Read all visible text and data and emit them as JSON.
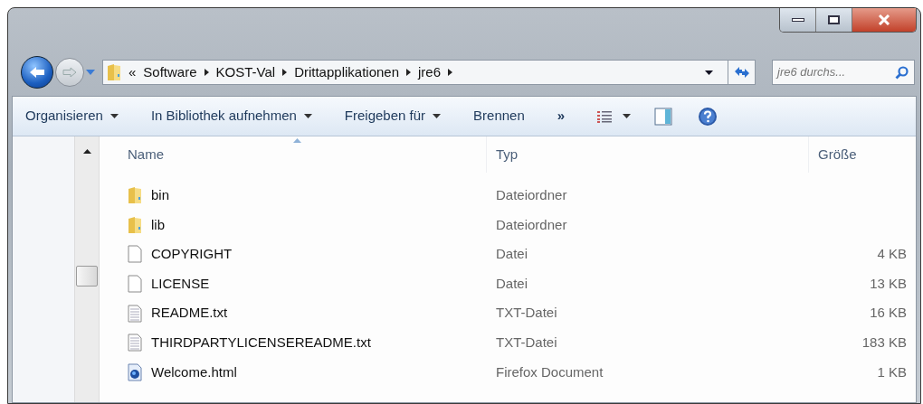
{
  "address_bar": {
    "overflow": "«",
    "path": [
      "Software",
      "KOST-Val",
      "Drittapplikationen",
      "jre6"
    ]
  },
  "search": {
    "placeholder": "jre6 durchs..."
  },
  "toolbar": {
    "items": [
      {
        "label": "Organisieren",
        "dropdown": true
      },
      {
        "label": "In Bibliothek aufnehmen",
        "dropdown": true
      },
      {
        "label": "Freigeben für",
        "dropdown": true
      },
      {
        "label": "Brennen",
        "dropdown": false
      }
    ],
    "overflow": "»"
  },
  "table": {
    "columns": [
      {
        "label": "Name",
        "sorted": true
      },
      {
        "label": "Typ",
        "sorted": false
      },
      {
        "label": "Größe",
        "sorted": false
      }
    ],
    "rows": [
      {
        "kind": "folder",
        "name": "bin",
        "type": "Dateiordner"
      },
      {
        "kind": "folder",
        "name": "lib",
        "type": "Dateiordner"
      },
      {
        "kind": "file",
        "name": "COPYRIGHT",
        "type": "Datei",
        "size": "4 KB"
      },
      {
        "kind": "file",
        "name": "LICENSE",
        "type": "Datei",
        "size": "13 KB"
      },
      {
        "kind": "text",
        "name": "README.txt",
        "type": "TXT-Datei",
        "size": "16 KB"
      },
      {
        "kind": "text",
        "name": "THIRDPARTYLICENSEREADME.txt",
        "type": "TXT-Datei",
        "size": "183 KB"
      },
      {
        "kind": "html",
        "name": "Welcome.html",
        "type": "Firefox Document",
        "size": "1 KB"
      }
    ]
  }
}
